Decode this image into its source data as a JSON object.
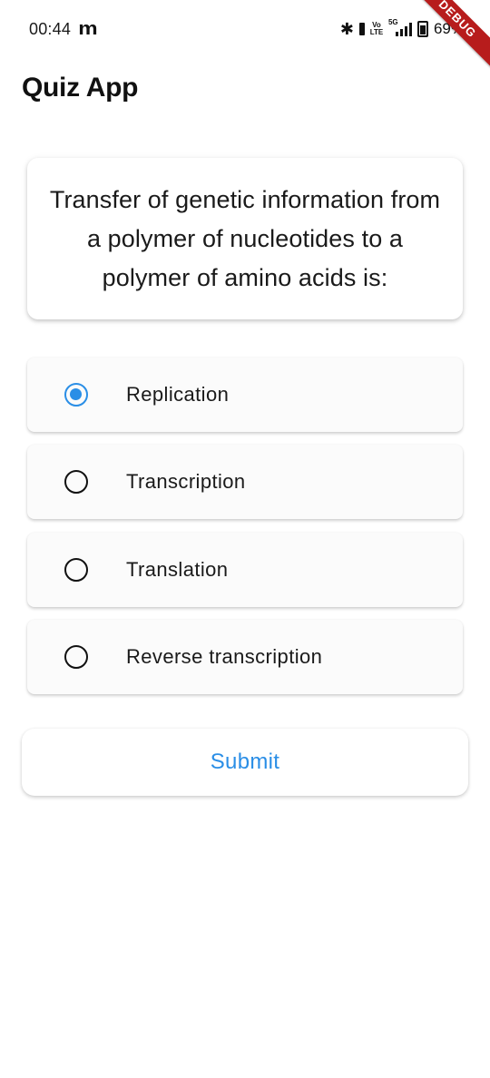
{
  "status_bar": {
    "time": "00:44",
    "carrier_icon": "m-logo-icon",
    "network_label": "5G",
    "volte_label": "Vo\nLTE",
    "battery": "69%"
  },
  "debug_banner": "DEBUG",
  "app_bar": {
    "title": "Quiz App"
  },
  "question": {
    "text": "Transfer of genetic information from a polymer of nucleotides to a polymer of amino acids is:"
  },
  "options": [
    {
      "label": "Replication",
      "selected": true
    },
    {
      "label": "Transcription",
      "selected": false
    },
    {
      "label": "Translation",
      "selected": false
    },
    {
      "label": "Reverse transcription",
      "selected": false
    }
  ],
  "submit": {
    "label": "Submit"
  },
  "colors": {
    "accent": "#2a8ee6",
    "ribbon": "#b71c1c"
  }
}
